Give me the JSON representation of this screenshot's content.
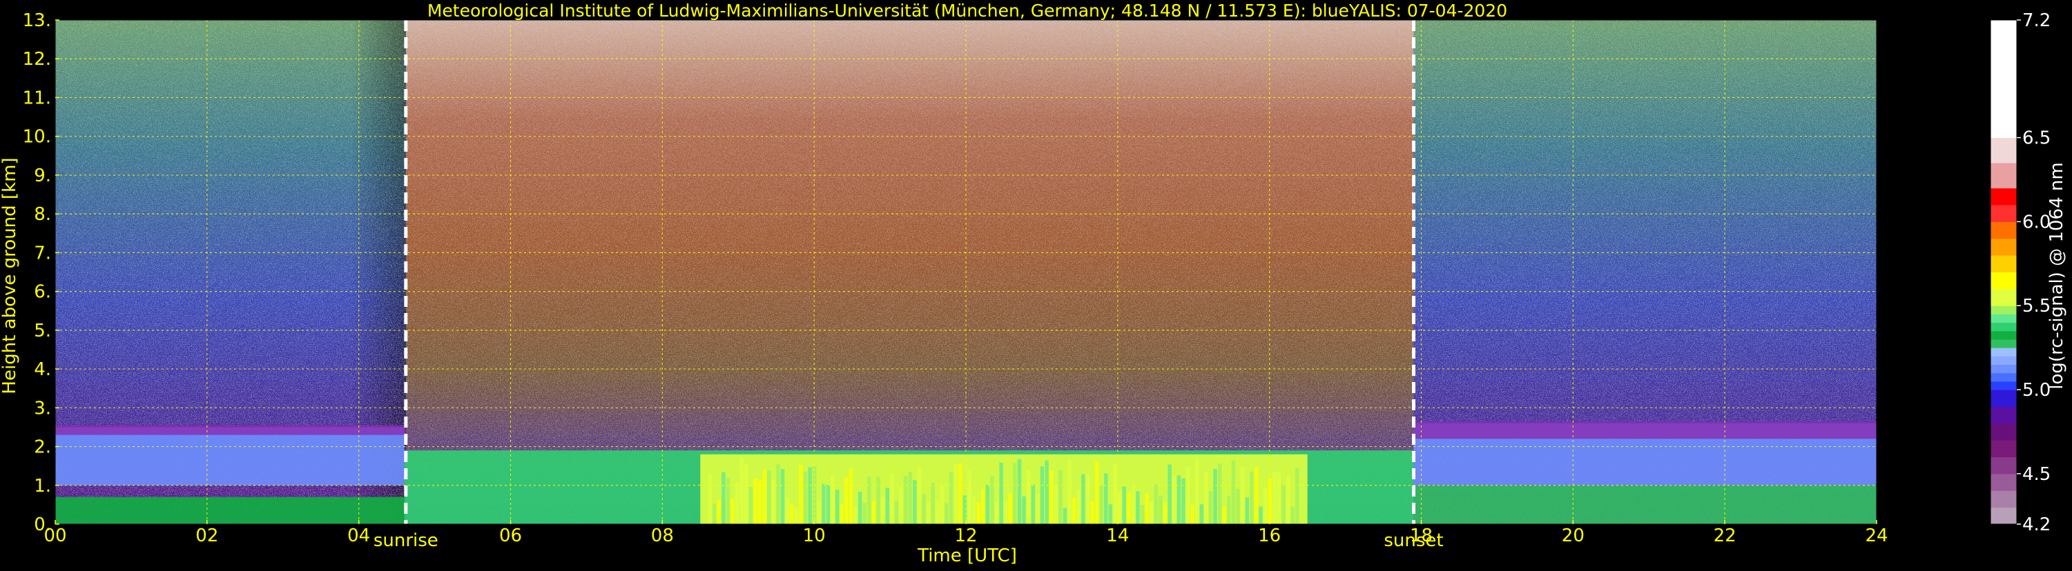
{
  "chart_data": {
    "type": "heatmap",
    "title": "Meteorological Institute of Ludwig-Maximilians-Universität (München, Germany; 48.148 N / 11.573 E):     blueYALIS: 07-04-2020",
    "xlabel": "Time [UTC]",
    "ylabel": "Height above ground [km]",
    "xlim": [
      0,
      24
    ],
    "ylim": [
      0,
      13
    ],
    "x_ticks": [
      0,
      2,
      4,
      6,
      8,
      10,
      12,
      14,
      16,
      18,
      20,
      22,
      24
    ],
    "x_tick_labels": [
      "00",
      "02",
      "04",
      "06",
      "08",
      "10",
      "12",
      "14",
      "16",
      "18",
      "20",
      "22",
      "24"
    ],
    "y_ticks": [
      0,
      1,
      2,
      3,
      4,
      5,
      6,
      7,
      8,
      9,
      10,
      11,
      12,
      13
    ],
    "y_tick_labels": [
      "0.",
      "1.",
      "2.",
      "3.",
      "4.",
      "5.",
      "6.",
      "7.",
      "8.",
      "9.",
      "10.",
      "11.",
      "12.",
      "13."
    ],
    "grid": true,
    "events": [
      {
        "label": "sunrise",
        "time": 4.62
      },
      {
        "label": "sunset",
        "time": 17.9
      }
    ],
    "colorbar": {
      "label": "log(rc-signal) @ 1064 nm",
      "range": [
        4.2,
        7.2
      ],
      "ticks": [
        4.2,
        4.5,
        5.0,
        5.5,
        6.0,
        6.5,
        7.2
      ],
      "tick_labels": [
        "4.2",
        "4.5",
        "5.0",
        "5.5",
        "6.0",
        "6.5",
        "7.2"
      ],
      "levels": [
        {
          "value": 4.2,
          "color": "#b8a0b8"
        },
        {
          "value": 4.3,
          "color": "#a880a8"
        },
        {
          "value": 4.4,
          "color": "#985c98"
        },
        {
          "value": 4.5,
          "color": "#8a3a8a"
        },
        {
          "value": 4.6,
          "color": "#7a1a7a"
        },
        {
          "value": 4.7,
          "color": "#68107a"
        },
        {
          "value": 4.8,
          "color": "#5a10a0"
        },
        {
          "value": 4.9,
          "color": "#3018d8"
        },
        {
          "value": 5.0,
          "color": "#2a40ff"
        },
        {
          "value": 5.05,
          "color": "#4a70ff"
        },
        {
          "value": 5.1,
          "color": "#6e90ff"
        },
        {
          "value": 5.15,
          "color": "#8aa8ff"
        },
        {
          "value": 5.2,
          "color": "#9cc0ff"
        },
        {
          "value": 5.25,
          "color": "#30c060"
        },
        {
          "value": 5.3,
          "color": "#10b040"
        },
        {
          "value": 5.35,
          "color": "#30d070"
        },
        {
          "value": 5.4,
          "color": "#60e890"
        },
        {
          "value": 5.45,
          "color": "#a0f060"
        },
        {
          "value": 5.5,
          "color": "#e0ff40"
        },
        {
          "value": 5.6,
          "color": "#ffff00"
        },
        {
          "value": 5.7,
          "color": "#ffd000"
        },
        {
          "value": 5.8,
          "color": "#ffa000"
        },
        {
          "value": 5.9,
          "color": "#ff7000"
        },
        {
          "value": 6.0,
          "color": "#ff3030"
        },
        {
          "value": 6.1,
          "color": "#ff0000"
        },
        {
          "value": 6.2,
          "color": "#e8a0a0"
        },
        {
          "value": 6.35,
          "color": "#f0d8d8"
        },
        {
          "value": 6.5,
          "color": "#ffffff"
        },
        {
          "value": 7.2,
          "color": "#ffffff"
        }
      ]
    },
    "regions": [
      {
        "name": "night-aerosol-layer-morning",
        "t0": 0,
        "t1": 4.6,
        "h0": 1.0,
        "h1": 2.5,
        "value": 5.1
      },
      {
        "name": "night-surface-layer-morning",
        "t0": 0,
        "t1": 4.6,
        "h0": 0.0,
        "h1": 0.7,
        "value": 5.3
      },
      {
        "name": "daytime-boundary-layer",
        "t0": 4.6,
        "t1": 17.9,
        "h0": 0.0,
        "h1": 1.9,
        "value": 5.35
      },
      {
        "name": "convective-plumes",
        "t0": 8.5,
        "t1": 16.5,
        "h0": 0.0,
        "h1": 1.8,
        "value": 5.5
      },
      {
        "name": "night-aerosol-layer-evening",
        "t0": 17.9,
        "t1": 24,
        "h0": 1.0,
        "h1": 2.6,
        "value": 5.1
      },
      {
        "name": "night-surface-layer-evening",
        "t0": 17.9,
        "t1": 24,
        "h0": 0.0,
        "h1": 1.0,
        "value": 5.25
      },
      {
        "name": "night-noise-free-troposphere",
        "t0": 0,
        "t1": 4.6,
        "h0": 2.5,
        "h1": 13,
        "value": 4.6
      },
      {
        "name": "day-noise-free-troposphere",
        "t0": 4.6,
        "t1": 17.9,
        "h0": 1.9,
        "h1": 13,
        "value": 6.0
      }
    ]
  }
}
